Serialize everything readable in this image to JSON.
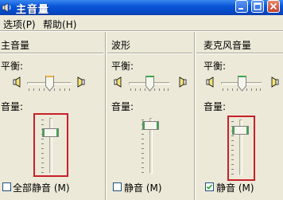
{
  "window": {
    "title": "主音量"
  },
  "menu": {
    "options": "选项",
    "options_key": "(P)",
    "help": "帮助",
    "help_key": "(H)"
  },
  "columns": [
    {
      "title": "主音量",
      "balance_label": "平衡:",
      "volume_label": "音量:",
      "mute_label": "全部静音",
      "mute_key": "(M)",
      "muted": false,
      "balance": 0.5,
      "volume": 0.8
    },
    {
      "title": "波形",
      "balance_label": "平衡:",
      "volume_label": "音量:",
      "mute_label": "静音",
      "mute_key": "(M)",
      "muted": false,
      "balance": 0.5,
      "volume": 0.85
    },
    {
      "title": "麦克风音量",
      "balance_label": "平衡:",
      "volume_label": "音量:",
      "mute_label": "静音",
      "mute_key": "(M)",
      "muted": true,
      "balance": 0.5,
      "volume": 0.8
    }
  ],
  "colors": {
    "titlebar": "#0a57d8",
    "highlight_box": "#c8202a",
    "window_bg": "#ece9d8",
    "thumb_accent": "#3aa84c"
  },
  "icons": [
    "volume-icon",
    "minimize-icon",
    "maximize-icon",
    "close-icon",
    "speaker-left-icon",
    "speaker-right-icon",
    "checkmark-icon"
  ]
}
